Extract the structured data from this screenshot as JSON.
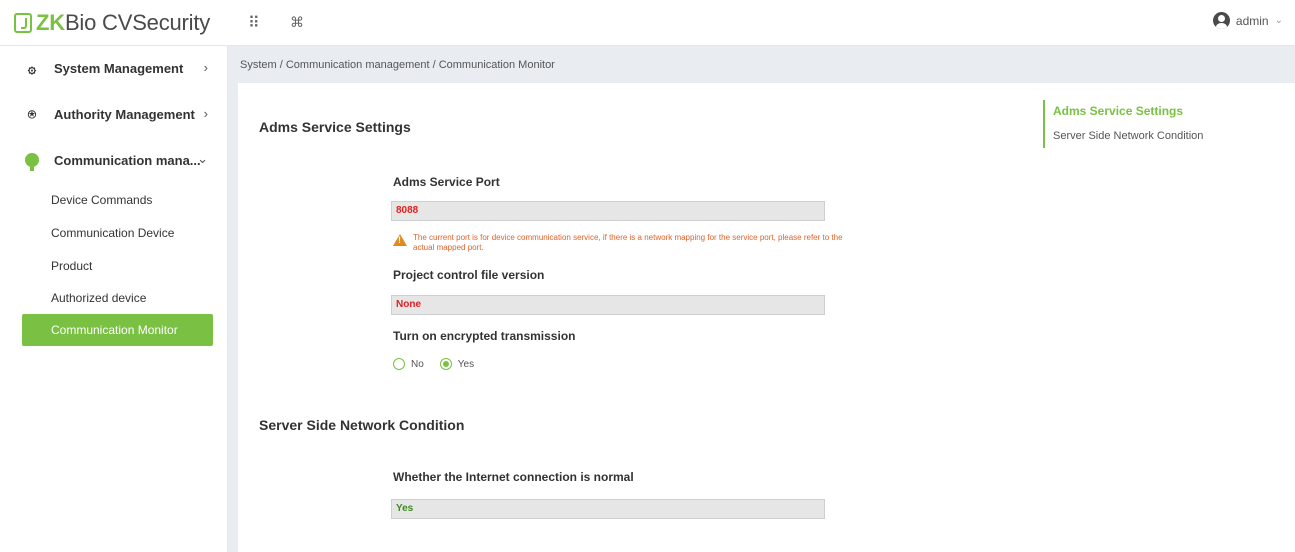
{
  "app": {
    "logo_brand": "ZK",
    "logo_rest": "Bio CVSecurity",
    "accent_color": "#7ac143"
  },
  "topbar": {
    "apps_icon": "grid-apps-icon",
    "apps_glyph": "⠿",
    "command_icon": "command-key-icon",
    "command_glyph": "⌘",
    "user_name": "admin",
    "user_chevron": "⌄"
  },
  "sidebar": {
    "items": [
      {
        "label": "System Management",
        "icon": "gear-cog-icon",
        "glyph": "۞",
        "chevron": "›"
      },
      {
        "label": "Authority Management",
        "icon": "shield-icon",
        "glyph": "⍟",
        "chevron": "›"
      },
      {
        "label": "Communication mana...",
        "icon": "communication-icon",
        "chevron": "⌄"
      }
    ],
    "sub_items": [
      {
        "label": "Device Commands"
      },
      {
        "label": "Communication Device"
      },
      {
        "label": "Product"
      },
      {
        "label": "Authorized device"
      },
      {
        "label": "Communication Monitor",
        "active": true
      }
    ]
  },
  "breadcrumb": "System / Communication management / Communication Monitor",
  "main": {
    "adms_section": {
      "title": "Adms Service Settings",
      "port_label": "Adms Service Port",
      "port_value": "8088",
      "warning_text": "The current port is for device communication service, if there is a network mapping for the service port, please refer to the actual mapped port.",
      "project_label": "Project control file version",
      "project_value": "None",
      "encrypt_label": "Turn on encrypted transmission",
      "encrypt_options": [
        "No",
        "Yes"
      ],
      "encrypt_selected": "Yes"
    },
    "network_section": {
      "title": "Server Side Network Condition",
      "internet_label": "Whether the Internet connection is normal",
      "internet_value": "Yes"
    }
  },
  "anchor_nav": {
    "items": [
      "Adms Service Settings",
      "Server Side Network Condition"
    ],
    "active": "Adms Service Settings"
  }
}
